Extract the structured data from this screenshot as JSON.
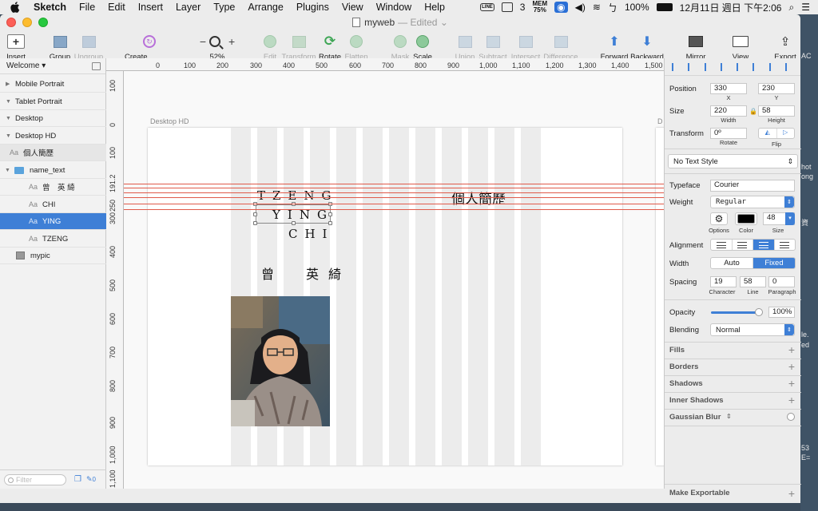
{
  "menubar": {
    "apple": "",
    "app": "Sketch",
    "items": [
      "File",
      "Edit",
      "Insert",
      "Layer",
      "Type",
      "Arrange",
      "Plugins",
      "View",
      "Window",
      "Help"
    ],
    "status": {
      "line": "LINE",
      "count": "3",
      "mem_top": "MEM",
      "mem_val": "75%",
      "battery": "100%",
      "datetime": "12月11日 週日 下午2:06",
      "input": "ㄅ"
    }
  },
  "window": {
    "doc_title": "myweb",
    "edited": "— Edited ⌄"
  },
  "toolbar": {
    "insert": "Insert",
    "group": "Group",
    "ungroup": "Ungroup",
    "create_symbol": "Create Symbol",
    "zoom_minus": "−",
    "zoom_plus": "+",
    "zoom": "52%",
    "edit": "Edit",
    "transform": "Transform",
    "rotate": "Rotate",
    "flatten": "Flatten",
    "mask": "Mask",
    "scale": "Scale",
    "union": "Union",
    "subtract": "Subtract",
    "intersect": "Intersect",
    "difference": "Difference",
    "forward": "Forward",
    "backward": "Backward",
    "mirror": "Mirror",
    "view": "View",
    "export": "Export"
  },
  "pages": {
    "current": "Welcome ▾"
  },
  "layers": [
    {
      "label": "Mobile Portrait",
      "kind": "artboard"
    },
    {
      "label": "Tablet Portrait",
      "kind": "artboard-open"
    },
    {
      "label": "Desktop",
      "kind": "artboard-open"
    },
    {
      "label": "Desktop HD",
      "kind": "artboard-open"
    },
    {
      "label": "個人簡歷",
      "kind": "text"
    },
    {
      "label": "name_text",
      "kind": "group"
    },
    {
      "label": "曾　英 綺",
      "kind": "text"
    },
    {
      "label": "CHI",
      "kind": "text"
    },
    {
      "label": "YING",
      "kind": "text",
      "selected": true
    },
    {
      "label": "TZENG",
      "kind": "text"
    },
    {
      "label": "mypic",
      "kind": "image"
    }
  ],
  "filter": {
    "placeholder": "Filter",
    "count": "0"
  },
  "ruler_h": [
    "0",
    "100",
    "200",
    "300",
    "400",
    "500",
    "600",
    "700",
    "800",
    "900",
    "1,000",
    "1,100",
    "1,200",
    "1,300",
    "1,400",
    "1,500"
  ],
  "ruler_v": [
    "100",
    "0",
    "100",
    "191.2",
    "250",
    "300",
    "400",
    "500",
    "600",
    "700",
    "800",
    "900",
    "1,000",
    "1,100"
  ],
  "canvas": {
    "artboard_label": "Desktop HD",
    "artboard2_label": "D",
    "name_lines": [
      "TZENG",
      "YING",
      "CHI"
    ],
    "cjk_name": "曾　英綺",
    "heading": "個人簡歷"
  },
  "inspector": {
    "position_label": "Position",
    "pos_x": "330",
    "pos_y": "230",
    "x_label": "X",
    "y_label": "Y",
    "size_label": "Size",
    "width": "220",
    "height": "58",
    "width_label": "Width",
    "height_label": "Height",
    "transform_label": "Transform",
    "rotate_val": "0º",
    "rotate_label": "Rotate",
    "flip_label": "Flip",
    "text_style": "No Text Style",
    "typeface_label": "Typeface",
    "typeface": "Courier",
    "weight_label": "Weight",
    "weight": "Regular",
    "options_label": "Options",
    "color_label": "Color",
    "font_size": "48",
    "alignment_label": "Alignment",
    "width_mode_label": "Width",
    "auto": "Auto",
    "fixed": "Fixed",
    "spacing_label": "Spacing",
    "character": "19",
    "line": "58",
    "paragraph": "0",
    "character_label": "Character",
    "line_label": "Line",
    "paragraph_label": "Paragraph",
    "opacity_label": "Opacity",
    "opacity": "100%",
    "blending_label": "Blending",
    "blending": "Normal",
    "sections": [
      "Fills",
      "Borders",
      "Shadows",
      "Inner Shadows",
      "Gaussian Blur"
    ],
    "make_exportable": "Make Exportable"
  },
  "desktop_peek": [
    "AC",
    "hot",
    "ong",
    "資",
    "le.",
    "ed",
    "53",
    "E="
  ],
  "colors": {
    "accent": "#3e7fd6",
    "guide": "#e05a4a"
  }
}
